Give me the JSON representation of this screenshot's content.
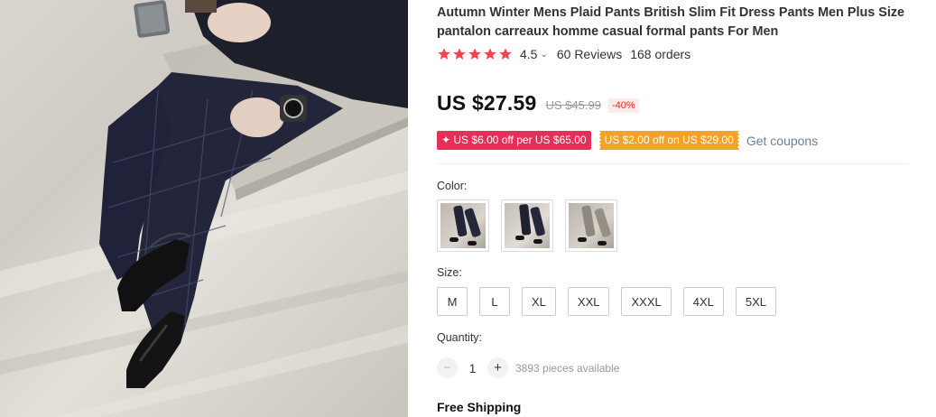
{
  "product": {
    "title": "Autumn Winter Mens Plaid Pants British Slim Fit Dress Pants Men Plus Size pantalon carreaux homme casual formal pants For Men",
    "image_icon": "product-photo-plaid-pants"
  },
  "rating": {
    "stars": 5,
    "star_color": "#f0454f",
    "score": "4.5",
    "reviews": "60 Reviews",
    "orders": "168 orders"
  },
  "price": {
    "current": "US $27.59",
    "original": "US $45.99",
    "discount": "-40%"
  },
  "coupons": {
    "store_coupon": "✦ US $6.00 off per US $65.00",
    "seller_coupon": "US $2.00 off on US $29.00",
    "get_coupons": "Get coupons"
  },
  "color": {
    "label": "Color:",
    "options": [
      "navy-plaid-1",
      "navy-plaid-2",
      "grey-plaid"
    ]
  },
  "size": {
    "label": "Size:",
    "options": [
      "M",
      "L",
      "XL",
      "XXL",
      "XXXL",
      "4XL",
      "5XL"
    ]
  },
  "quantity": {
    "label": "Quantity:",
    "minus": "−",
    "plus": "+",
    "value": "1",
    "available": "3893 pieces available"
  },
  "shipping": {
    "label": "Free Shipping"
  }
}
